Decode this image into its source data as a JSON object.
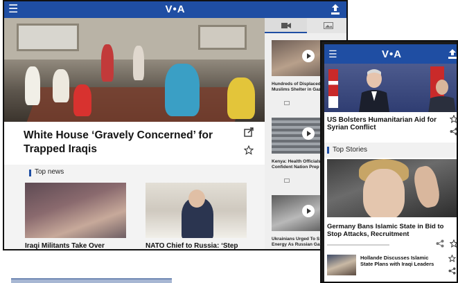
{
  "tablet": {
    "logo": "V•A",
    "hero_headline": "White House ‘Gravely Concerned’ for Trapped Iraqis",
    "section_label": "Top news",
    "cards": [
      {
        "title": "Iraqi Militants Take Over"
      },
      {
        "title": "NATO Chief to Russia: ‘Step"
      }
    ],
    "side_stories": [
      {
        "title_line1": "Hundreds of Displaced",
        "title_line2": "Muslims Shelter in Gaz"
      },
      {
        "title_line1": "Kenya: Health Officials",
        "title_line2": "Confident Nation Prep"
      },
      {
        "title_line1": "Ukrainians Urged To S",
        "title_line2": "Energy As Russian Gas"
      }
    ],
    "icons": {
      "menu": "hamburger-icon",
      "share": "upload-share-icon",
      "video_tab": "video-camera-icon",
      "photo_tab": "photo-gallery-icon",
      "external": "open-external-icon",
      "favorite": "star-icon",
      "play": "play-icon"
    }
  },
  "phone": {
    "logo": "V•A",
    "headline": "US Bolsters Humanitarian Aid for Syrian Conflict",
    "section_label": "Top Stories",
    "story_title": "Germany Bans Islamic State in Bid to Stop Attacks, Recruitment",
    "list_item": "Hollande Discusses Islamic State Plans with Iraqi Leaders"
  },
  "colors": {
    "brand_blue": "#1f4ea3",
    "device_frame": "#1c1c1c"
  }
}
